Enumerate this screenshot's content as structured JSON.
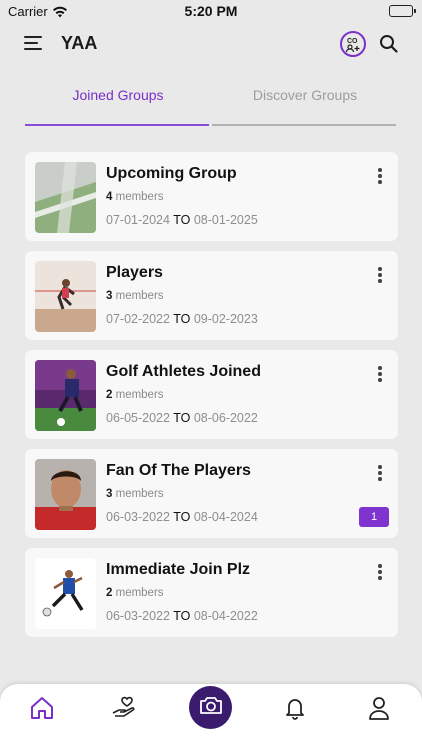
{
  "status": {
    "carrier": "Carrier",
    "time": "5:20 PM",
    "battery_level": 1.0
  },
  "header": {
    "title": "YAA",
    "icons": [
      "menu-icon",
      "add-group-icon",
      "search-icon"
    ],
    "add_group_icon_text": "CO",
    "accent_color": "#7b2fc9"
  },
  "tabs": [
    {
      "label": "Joined Groups",
      "active": true
    },
    {
      "label": "Discover Groups",
      "active": false
    }
  ],
  "groups": [
    {
      "name": "Upcoming Group",
      "member_count": "4",
      "members_word": "members",
      "start": "07-01-2024",
      "to": "TO",
      "end": "08-01-2025",
      "badge": ""
    },
    {
      "name": "Players",
      "member_count": "3",
      "members_word": "members",
      "start": "07-02-2022",
      "to": "TO",
      "end": "09-02-2023",
      "badge": ""
    },
    {
      "name": "Golf Athletes Joined",
      "member_count": "2",
      "members_word": "members",
      "start": "06-05-2022",
      "to": "TO",
      "end": "08-06-2022",
      "badge": ""
    },
    {
      "name": "Fan Of The Players",
      "member_count": "3",
      "members_word": "members",
      "start": "06-03-2022",
      "to": "TO",
      "end": "08-04-2024",
      "badge": "1"
    },
    {
      "name": "Immediate Join Plz",
      "member_count": "2",
      "members_word": "members",
      "start": "06-03-2022",
      "to": "TO",
      "end": "08-04-2022",
      "badge": ""
    }
  ],
  "bottom_nav": {
    "items": [
      "home-icon",
      "hand-heart-icon",
      "camera-icon",
      "bell-icon",
      "profile-icon"
    ],
    "active": "home-icon",
    "camera_bg": "#3a1b6e"
  }
}
